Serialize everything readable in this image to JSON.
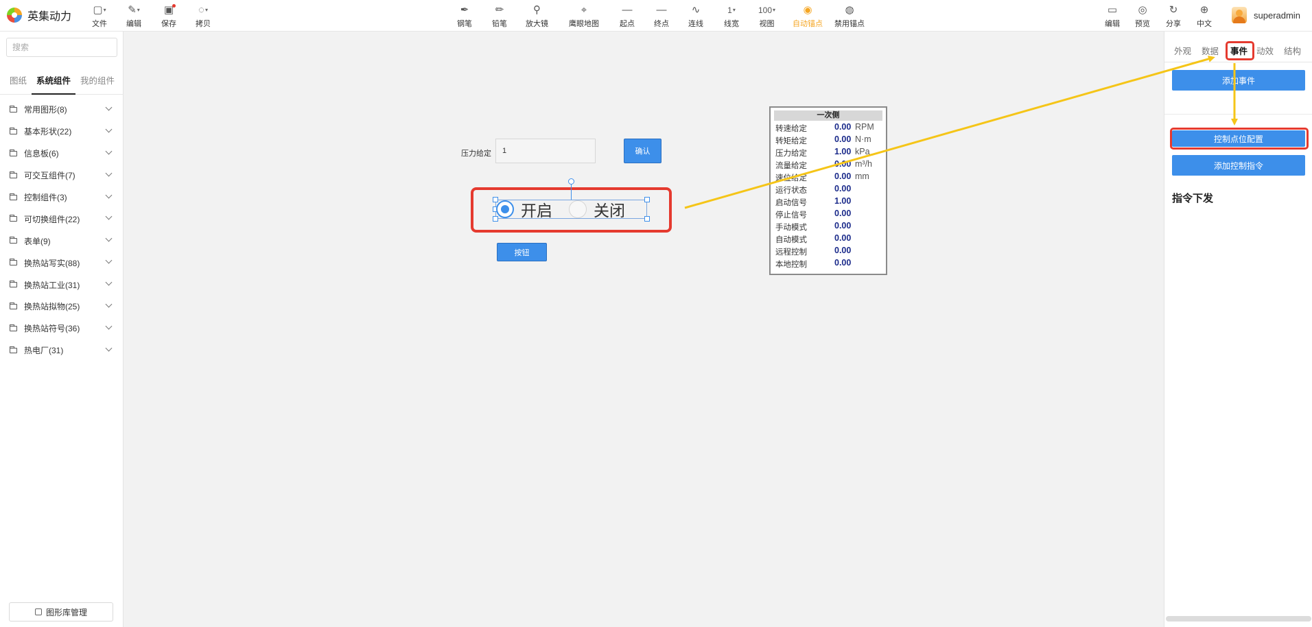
{
  "app": {
    "title": "英集动力"
  },
  "toolbar": {
    "left": [
      {
        "label": "文件",
        "icon": "file-icon"
      },
      {
        "label": "编辑",
        "icon": "edit-icon"
      },
      {
        "label": "保存",
        "icon": "save-icon"
      },
      {
        "label": "拷贝",
        "icon": "copy-icon"
      }
    ],
    "center": [
      {
        "label": "钢笔",
        "icon": "pen-icon"
      },
      {
        "label": "铅笔",
        "icon": "pencil-icon"
      },
      {
        "label": "放大镜",
        "icon": "magnifier-icon"
      },
      {
        "label": "鹰眼地图",
        "icon": "map-pin-icon"
      },
      {
        "label": "起点",
        "icon": "line-start-icon"
      },
      {
        "label": "终点",
        "icon": "line-end-icon"
      },
      {
        "label": "连线",
        "icon": "curve-icon"
      },
      {
        "label": "线宽",
        "value": "1"
      },
      {
        "label": "视图",
        "value": "100"
      },
      {
        "label": "自动锚点",
        "icon": "anchor-auto-icon",
        "active": true
      },
      {
        "label": "禁用锚点",
        "icon": "anchor-disable-icon"
      }
    ],
    "right": [
      {
        "label": "编辑",
        "icon": "folder-edit-icon"
      },
      {
        "label": "预览",
        "icon": "eye-icon"
      },
      {
        "label": "分享",
        "icon": "share-icon"
      },
      {
        "label": "中文",
        "icon": "globe-icon"
      }
    ],
    "user": "superadmin"
  },
  "sidebar": {
    "search_placeholder": "搜索",
    "tabs": [
      {
        "label": "图纸",
        "active": false
      },
      {
        "label": "系统组件",
        "active": true
      },
      {
        "label": "我的组件",
        "active": false
      }
    ],
    "categories": [
      "常用图形(8)",
      "基本形状(22)",
      "信息板(6)",
      "可交互组件(7)",
      "控制组件(3)",
      "可切换组件(22)",
      "表单(9)",
      "换热站写实(88)",
      "换热站工业(31)",
      "换热站拟物(25)",
      "换热站符号(36)",
      "热电厂(31)"
    ],
    "library_button": "图形库管理"
  },
  "canvas": {
    "pressure": {
      "label": "压力给定",
      "value": "1",
      "button": "确认"
    },
    "toggle": {
      "on_label": "开启",
      "off_label": "关闭",
      "selected": "开启"
    },
    "button": "按钮",
    "panel": {
      "title": "一次侧",
      "rows": [
        {
          "label": "转速给定",
          "value": "0.00",
          "unit": "RPM"
        },
        {
          "label": "转矩给定",
          "value": "0.00",
          "unit": "N·m"
        },
        {
          "label": "压力给定",
          "value": "1.00",
          "unit": "kPa"
        },
        {
          "label": "流量给定",
          "value": "0.00",
          "unit": "m³/h"
        },
        {
          "label": "速位给定",
          "value": "0.00",
          "unit": "mm"
        },
        {
          "label": "运行状态",
          "value": "0.00",
          "unit": ""
        },
        {
          "label": "启动信号",
          "value": "1.00",
          "unit": ""
        },
        {
          "label": "停止信号",
          "value": "0.00",
          "unit": ""
        },
        {
          "label": "手动模式",
          "value": "0.00",
          "unit": ""
        },
        {
          "label": "自动模式",
          "value": "0.00",
          "unit": ""
        },
        {
          "label": "远程控制",
          "value": "0.00",
          "unit": ""
        },
        {
          "label": "本地控制",
          "value": "0.00",
          "unit": ""
        }
      ]
    }
  },
  "rightpanel": {
    "tabs": [
      {
        "label": "外观",
        "active": false
      },
      {
        "label": "数据",
        "active": false
      },
      {
        "label": "事件",
        "active": true
      },
      {
        "label": "动效",
        "active": false
      },
      {
        "label": "结构",
        "active": false
      }
    ],
    "add_event": "添加事件",
    "control_point_config": "控制点位配置",
    "add_control_command": "添加控制指令",
    "command_section": "指令下发"
  },
  "colors": {
    "primary": "#3d8fea",
    "highlight": "#e53a2f",
    "arrow": "#f5c518",
    "active_tool": "#f5a623",
    "canvas_bg": "#f2f2f2"
  }
}
